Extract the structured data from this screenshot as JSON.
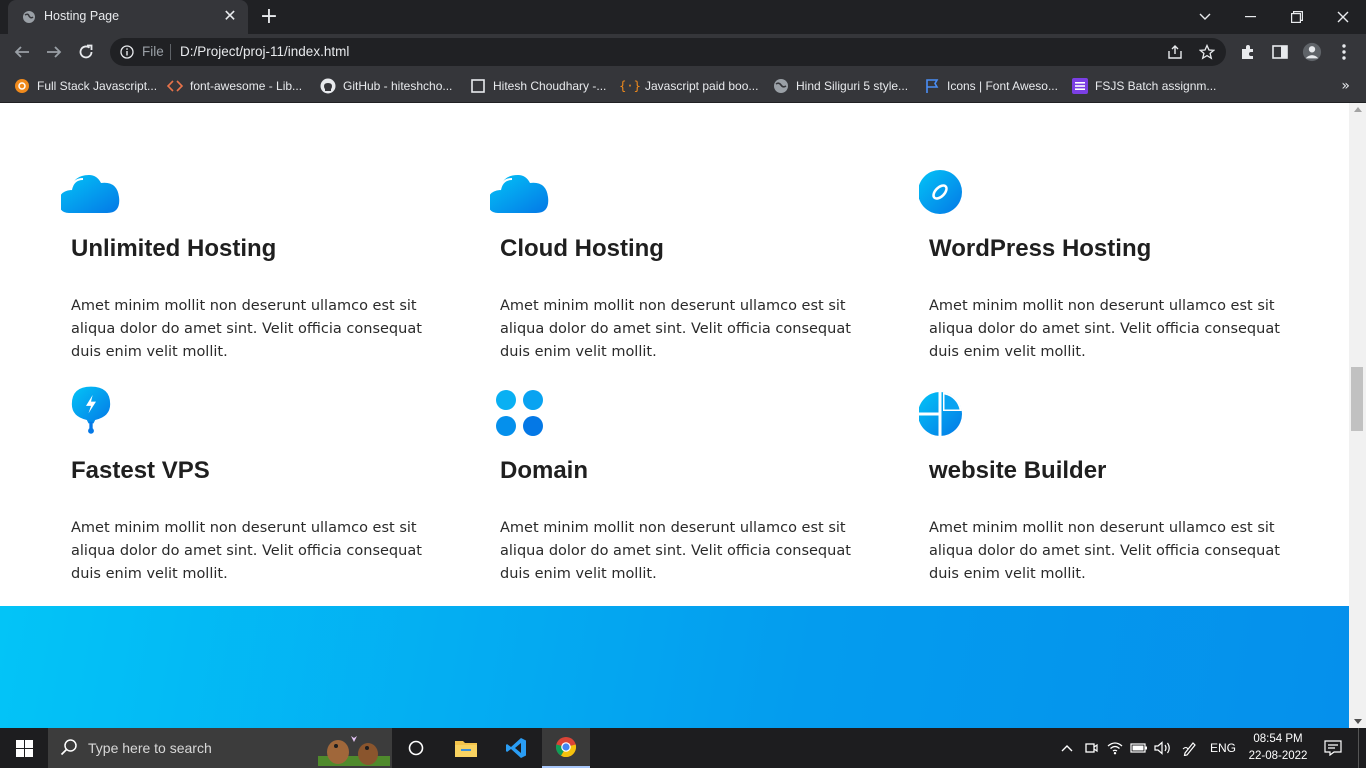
{
  "browser": {
    "tab_title": "Hosting Page",
    "close_tab": "✕",
    "new_tab": "+",
    "address_scheme": "File",
    "address_url": "D:/Project/proj-11/index.html",
    "bookmarks": [
      {
        "label": "Full Stack Javascript...",
        "icon": "ubuntu-circle-icon"
      },
      {
        "label": "font-awesome - Lib...",
        "icon": "code-brackets-icon"
      },
      {
        "label": "GitHub - hiteshcho...",
        "icon": "github-icon"
      },
      {
        "label": "Hitesh Choudhary -...",
        "icon": "square-icon"
      },
      {
        "label": "Javascript paid boo...",
        "icon": "curly-braces-icon"
      },
      {
        "label": "Hind Siliguri 5 style...",
        "icon": "globe-icon"
      },
      {
        "label": "Icons | Font Aweso...",
        "icon": "flag-icon"
      },
      {
        "label": "FSJS Batch assignm...",
        "icon": "list-icon"
      }
    ],
    "bookmarks_more": "»"
  },
  "features": [
    {
      "title": "Unlimited Hosting",
      "text": "Amet minim mollit non deserunt ullamco est sit aliqua dolor do amet sint. Velit officia consequat duis enim velit mollit.",
      "icon": "cloud-icon"
    },
    {
      "title": "Cloud Hosting",
      "text": "Amet minim mollit non deserunt ullamco est sit aliqua dolor do amet sint. Velit officia consequat duis enim velit mollit.",
      "icon": "cloud-icon"
    },
    {
      "title": "WordPress Hosting",
      "text": "Amet minim mollit non deserunt ullamco est sit aliqua dolor do amet sint. Velit officia consequat duis enim velit mollit.",
      "icon": "compass-icon"
    },
    {
      "title": "Fastest VPS",
      "text": "Amet minim mollit non deserunt ullamco est sit aliqua dolor do amet sint. Velit officia consequat duis enim velit mollit.",
      "icon": "bolt-pin-icon"
    },
    {
      "title": "Domain",
      "text": "Amet minim mollit non deserunt ullamco est sit aliqua dolor do amet sint. Velit officia consequat duis enim velit mollit.",
      "icon": "four-dots-icon"
    },
    {
      "title": "website Builder",
      "text": "Amet minim mollit non deserunt ullamco est sit aliqua dolor do amet sint. Velit officia consequat duis enim velit mollit.",
      "icon": "pie-grid-icon"
    }
  ],
  "taskbar": {
    "search_placeholder": "Type here to search",
    "language": "ENG",
    "time": "08:54 PM",
    "date": "22-08-2022"
  },
  "colors": {
    "icon_gradient_start": "#03c4f7",
    "icon_gradient_end": "#0478e6",
    "band_start": "#03c4f7",
    "band_end": "#0590ec"
  }
}
